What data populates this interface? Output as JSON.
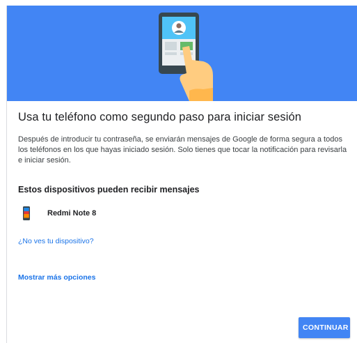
{
  "title": "Usa tu teléfono como segundo paso para iniciar sesión",
  "description": "Después de introducir tu contraseña, se enviarán mensajes de Google de forma segura a todos los teléfonos en los que hayas iniciado sesión. Solo tienes que tocar la notificación para revisarla e iniciar sesión.",
  "devices_section": {
    "heading": "Estos dispositivos pueden recibir mensajes",
    "devices": [
      {
        "name": "Redmi Note 8",
        "icon": "smartphone-icon"
      }
    ]
  },
  "links": {
    "missing_device": "¿No ves tu dispositivo?",
    "more_options": "Mostrar más opciones"
  },
  "actions": {
    "continue_label": "CONTINUAR"
  },
  "colors": {
    "hero_background": "#4285f4",
    "link": "#1a73e8",
    "primary_button": "#4285f4"
  }
}
